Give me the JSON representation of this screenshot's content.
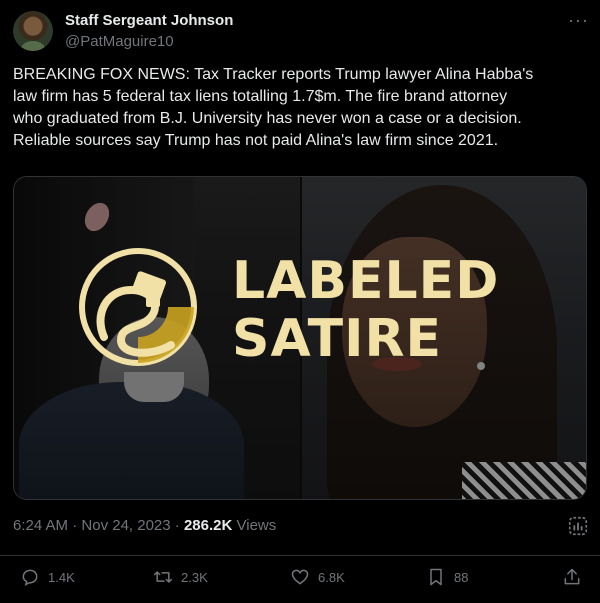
{
  "author": {
    "name": "Staff Sergeant Johnson",
    "handle": "@PatMaguire10"
  },
  "tweet": {
    "text": "BREAKING FOX NEWS: Tax Tracker reports Trump lawyer Alina Habba's\nlaw firm has 5 federal tax liens totalling 1.7$m. The fire brand attorney\nwho graduated from B.J. University has never won a case or a decision.\nReliable sources say Trump has not paid Alina's law firm since 2021."
  },
  "media": {
    "overlay_label_line1": "LABELED",
    "overlay_label_line2": "SATIRE",
    "overlay_color": "#f1e1a6",
    "logo_color": "#d9b83a"
  },
  "meta": {
    "time": "6:24 AM",
    "date": "Nov 24, 2023",
    "views_count": "286.2K",
    "views_label": "Views"
  },
  "actions": {
    "replies": "1.4K",
    "reposts": "2.3K",
    "likes": "6.8K",
    "bookmarks": "88"
  },
  "icons": {
    "more": "more-icon",
    "analytics": "analytics-icon",
    "reply": "reply-icon",
    "repost": "repost-icon",
    "like": "heart-icon",
    "bookmark": "bookmark-icon",
    "share": "share-icon"
  }
}
